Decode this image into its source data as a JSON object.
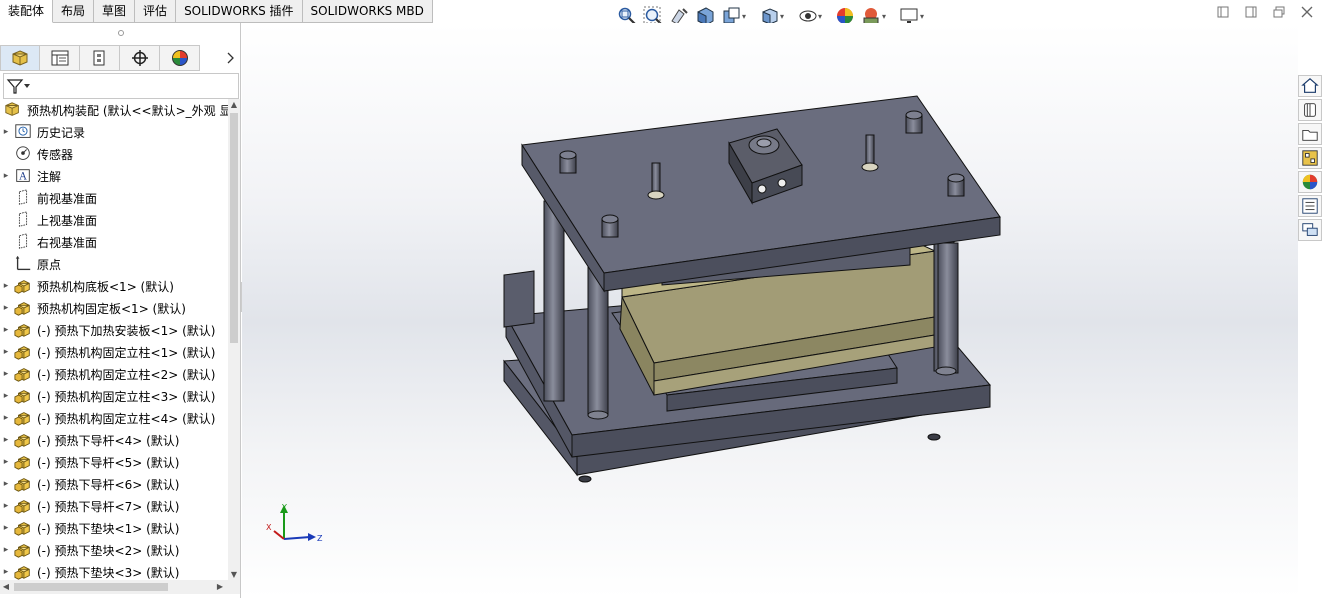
{
  "command_tabs": [
    "装配体",
    "布局",
    "草图",
    "评估",
    "SOLIDWORKS 插件",
    "SOLIDWORKS MBD"
  ],
  "active_tab_index": 0,
  "heads_up_toolbar": [
    {
      "icon": "zoom-to-fit-icon"
    },
    {
      "icon": "zoom-to-area-icon"
    },
    {
      "icon": "previous-view-icon"
    },
    {
      "icon": "section-view-icon"
    },
    {
      "icon": "dynamic-annotation-icon",
      "caret": true
    },
    {
      "icon": "view-orientation-icon",
      "caret": true
    },
    {
      "icon": "hide-show-items-icon",
      "caret": true
    },
    {
      "icon": "edit-appearance-icon"
    },
    {
      "icon": "apply-scene-icon",
      "caret": true
    },
    {
      "icon": "view-settings-icon",
      "caret": true
    }
  ],
  "window_controls": [
    "restore-down-left-icon",
    "restore-down-right-icon",
    "maximize-icon",
    "close-icon"
  ],
  "manager_tabs": [
    "featuremanager-tab",
    "propertymanager-tab",
    "configurationmanager-tab",
    "dimxpertmanager-tab",
    "displaymanager-tab"
  ],
  "tree": {
    "root": "预热机构装配  (默认<<默认>_外观 显",
    "items": [
      {
        "label": "历史记录",
        "icon": "history-icon",
        "expandable": true
      },
      {
        "label": "传感器",
        "icon": "sensor-icon",
        "expandable": false
      },
      {
        "label": "注解",
        "icon": "annotation-icon",
        "expandable": true
      },
      {
        "label": "前视基准面",
        "icon": "plane-icon",
        "expandable": false
      },
      {
        "label": "上视基准面",
        "icon": "plane-icon",
        "expandable": false
      },
      {
        "label": "右视基准面",
        "icon": "plane-icon",
        "expandable": false
      },
      {
        "label": "原点",
        "icon": "origin-icon",
        "expandable": false
      },
      {
        "label": "预热机构底板<1> (默认)",
        "icon": "part-icon",
        "expandable": true
      },
      {
        "label": "预热机构固定板<1> (默认)",
        "icon": "part-icon",
        "expandable": true
      },
      {
        "label": "(-) 预热下加热安装板<1> (默认)",
        "icon": "part-icon",
        "expandable": true
      },
      {
        "label": "(-) 预热机构固定立柱<1> (默认)",
        "icon": "part-icon",
        "expandable": true
      },
      {
        "label": "(-) 预热机构固定立柱<2> (默认)",
        "icon": "part-icon",
        "expandable": true
      },
      {
        "label": "(-) 预热机构固定立柱<3> (默认)",
        "icon": "part-icon",
        "expandable": true
      },
      {
        "label": "(-) 预热机构固定立柱<4> (默认)",
        "icon": "part-icon",
        "expandable": true
      },
      {
        "label": "(-) 预热下导杆<4> (默认)",
        "icon": "part-icon",
        "expandable": true
      },
      {
        "label": "(-) 预热下导杆<5> (默认)",
        "icon": "part-icon",
        "expandable": true
      },
      {
        "label": "(-) 预热下导杆<6> (默认)",
        "icon": "part-icon",
        "expandable": true
      },
      {
        "label": "(-) 预热下导杆<7> (默认)",
        "icon": "part-icon",
        "expandable": true
      },
      {
        "label": "(-) 预热下垫块<1> (默认)",
        "icon": "part-icon",
        "expandable": true
      },
      {
        "label": "(-) 预热下垫块<2> (默认)",
        "icon": "part-icon",
        "expandable": true
      },
      {
        "label": "(-) 预热下垫块<3> (默认)",
        "icon": "part-icon",
        "expandable": true
      }
    ]
  },
  "triad": {
    "x": "X",
    "y": "Y",
    "z": "Z"
  },
  "task_pane": [
    "home-icon",
    "design-library-icon",
    "file-explorer-icon",
    "view-palette-icon",
    "appearances-icon",
    "custom-properties-icon",
    "forum-icon"
  ],
  "colors": {
    "plate": "#5d6070",
    "plate_top": "#6a6d7e",
    "heater": "#9a9470",
    "heater_top": "#b5ae82"
  }
}
